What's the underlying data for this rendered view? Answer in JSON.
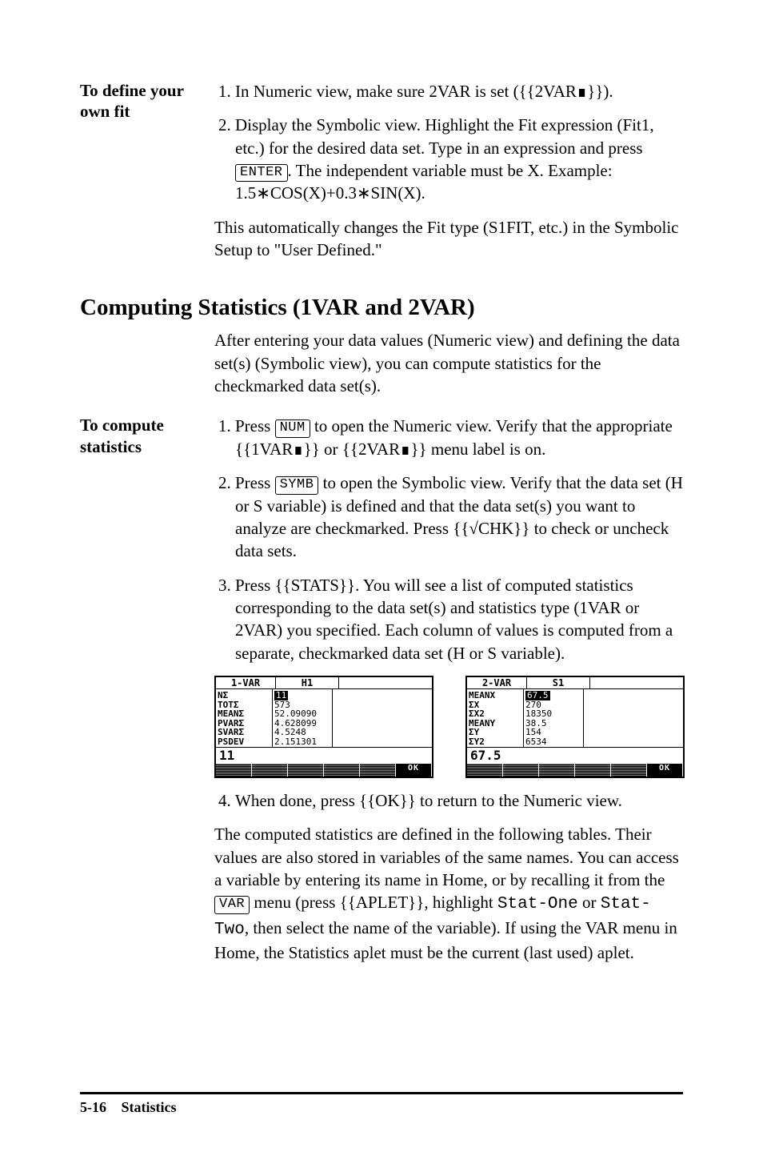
{
  "block1": {
    "side": "To define your own fit",
    "step1": "In Numeric view, make sure 2VAR is set ({{2VAR∎}}).",
    "step2a": "Display the Symbolic view. Highlight the Fit expression (Fit1, etc.) for the desired data set. Type in an expression and press ",
    "key_enter": "ENTER",
    "step2b": ". The independent variable must be X. Example: 1.5∗COS(X)+0.3∗SIN(X).",
    "after": "This automatically changes the Fit type (S1FIT, etc.) in the Symbolic Setup to \"User Defined.\""
  },
  "heading": "Computing Statistics (1VAR and 2VAR)",
  "intro": "After entering your data values (Numeric view) and defining the data set(s) (Symbolic view), you can compute statistics for the checkmarked data set(s).",
  "block2": {
    "side": "To compute statistics",
    "s1a": "Press ",
    "key_num": "NUM",
    "s1b": " to open the Numeric view. Verify that the appropriate {{1VAR∎}} or {{2VAR∎}} menu label is on.",
    "s2a": "Press ",
    "key_symb": "SYMB",
    "s2b": " to open the Symbolic view. Verify that the data set (H or S variable) is defined and that the data set(s) you want to analyze are checkmarked. Press {{√CHK}} to check or uncheck data sets.",
    "s3": "Press {{STATS}}. You will see a list of computed statistics corresponding to the data set(s) and statistics type (1VAR or 2VAR) you specified. Each column of values is computed from a separate, checkmarked data set (H or S variable).",
    "s4": "When done, press {{OK}} to return to the Numeric view."
  },
  "screens": {
    "left": {
      "hdr1": "1-VAR",
      "hdr2": "H1",
      "labels": "NΣ\nTOTΣ\nMEANΣ\nPVARΣ\nSVARΣ\nPSDEV",
      "val_hl": "11",
      "vals_rest": "573\n52.09090\n4.628099\n4.5248\n2.151301",
      "entry": "11",
      "ok": "OK"
    },
    "right": {
      "hdr1": "2-VAR",
      "hdr2": "S1",
      "labels": "MEANX\nΣX\nΣX2\nMEANY\nΣY\nΣY2",
      "val_hl": "67.5",
      "vals_rest": "270\n18350\n38.5\n154\n6534",
      "entry": "67.5",
      "ok": "OK"
    }
  },
  "tail": {
    "p1a": "The computed statistics are defined in the following tables. Their values are also stored in variables of the same names. You can access a variable by entering its name in Home, or by recalling it from the ",
    "key_var": "VAR",
    "p1b": " menu (press {{APLET}}, highlight ",
    "code1": "Stat-One",
    "mid": " or ",
    "code2": "Stat-Two",
    "p1c": ", then select the name of the variable). If using the VAR menu in Home, the Statistics aplet must be the current (last used) aplet."
  },
  "footer": {
    "page": "5-16",
    "section": "Statistics"
  }
}
